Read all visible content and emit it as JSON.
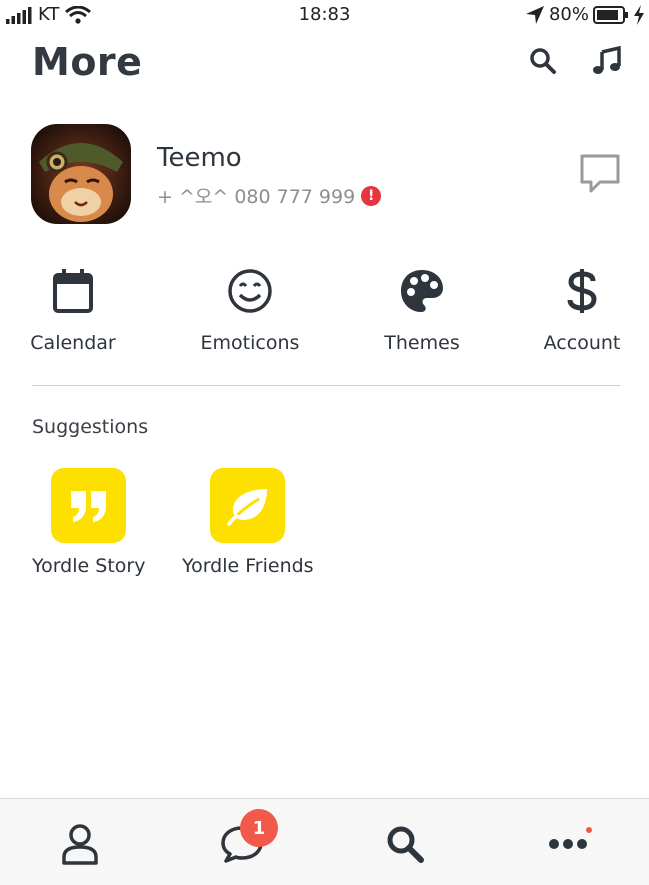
{
  "status_bar": {
    "carrier": "KT",
    "time": "18:83",
    "battery": "80%"
  },
  "header": {
    "title": "More"
  },
  "profile": {
    "name": "Teemo",
    "phone": "+ ^오^ 080 777 999",
    "warning_mark": "!"
  },
  "quick_actions": [
    {
      "label": "Calendar",
      "icon": "calendar-icon"
    },
    {
      "label": "Emoticons",
      "icon": "smiley-icon"
    },
    {
      "label": "Themes",
      "icon": "palette-icon"
    },
    {
      "label": "Account",
      "icon": "dollar-icon"
    }
  ],
  "suggestions": {
    "title": "Suggestions",
    "items": [
      {
        "label": "Yordle Story",
        "icon": "quote-icon"
      },
      {
        "label": "Yordle Friends",
        "icon": "leaf-icon"
      }
    ]
  },
  "tabbar": {
    "chats_badge": "1"
  },
  "colors": {
    "accent": "#fde000",
    "badge": "#f2594a",
    "text": "#333941",
    "warning": "#e8343c"
  }
}
